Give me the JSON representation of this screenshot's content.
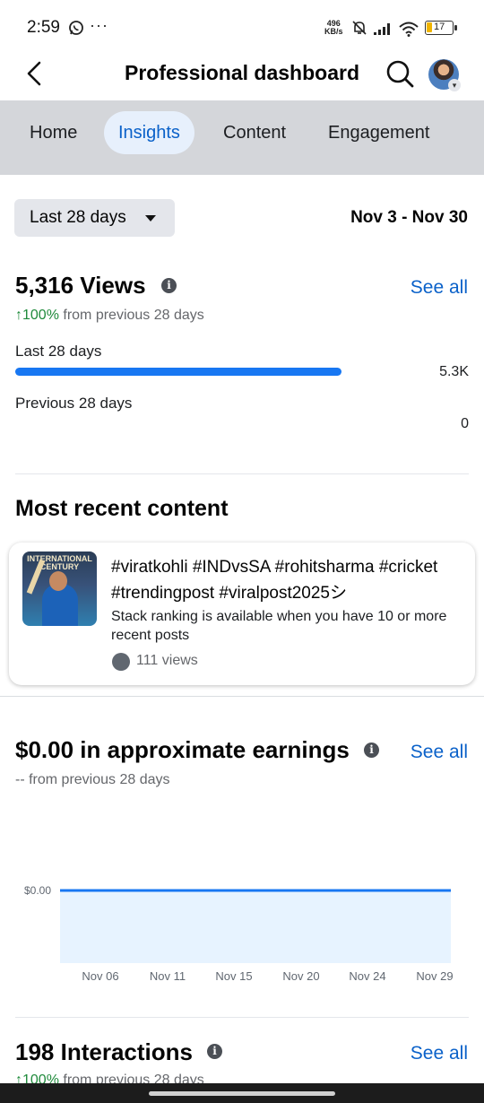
{
  "status_bar": {
    "time": "2:59",
    "net_speed_value": "496",
    "net_speed_unit": "KB/s",
    "battery": "17"
  },
  "header": {
    "title": "Professional dashboard"
  },
  "tabs": [
    {
      "label": "Home"
    },
    {
      "label": "Insights"
    },
    {
      "label": "Content"
    },
    {
      "label": "Engagement"
    }
  ],
  "active_tab": "Insights",
  "date_filter": {
    "selected": "Last 28 days",
    "range": "Nov 3 - Nov 30"
  },
  "views": {
    "title": "5,316 Views",
    "see_all": "See all",
    "change_pct": "100%",
    "change_text": "from previous 28 days",
    "current_label": "Last 28 days",
    "current_value": "5.3K",
    "previous_label": "Previous 28 days",
    "previous_value": "0",
    "current_fraction": 1.0
  },
  "recent": {
    "heading": "Most recent content",
    "post_title": "#viratkohli #INDvsSA #rohitsharma #cricket #trendingpost #viralpost2025シ",
    "post_desc": "Stack ranking is available when you have 10 or more recent posts",
    "post_views": "111 views",
    "thumb_text_1": "INTERNATIONAL",
    "thumb_text_2": "CENTURY"
  },
  "earnings": {
    "title": "$0.00 in approximate earnings",
    "see_all": "See all",
    "change_text": "-- from previous 28 days",
    "chart_data": {
      "type": "area",
      "x": [
        "Nov 06",
        "Nov 11",
        "Nov 15",
        "Nov 20",
        "Nov 24",
        "Nov 29"
      ],
      "series": [
        {
          "values": [
            0,
            0,
            0,
            0,
            0,
            0
          ]
        }
      ],
      "y_tick_labels": [
        "$0.00"
      ],
      "line_color": "#1877f2",
      "fill_color": "#e7f3ff"
    }
  },
  "interactions": {
    "title": "198 Interactions",
    "see_all": "See all",
    "change_pct": "100%",
    "change_text": "from previous 28 days"
  },
  "colors": {
    "accent": "#0a61c9",
    "bar": "#1877f2",
    "positive": "#1f8a3b",
    "tab_bg": "#d4d6da"
  }
}
